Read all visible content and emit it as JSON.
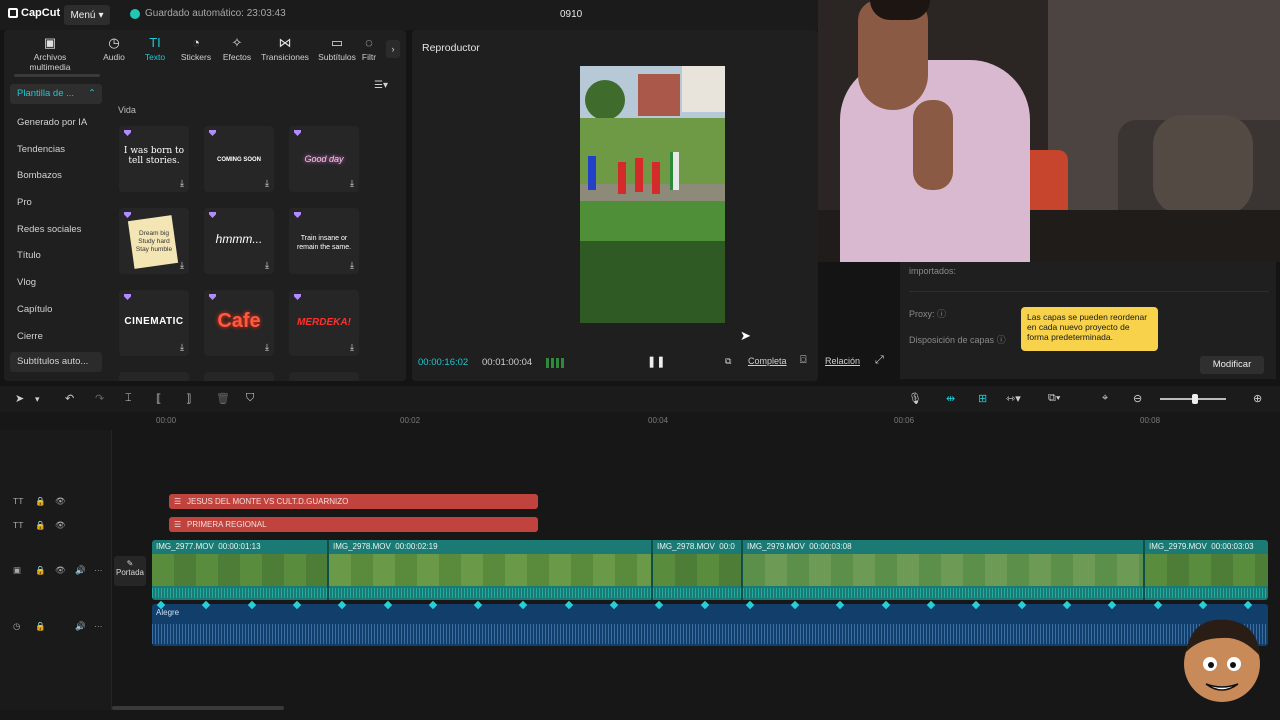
{
  "app": {
    "logo": "CapCut",
    "menu_label": "Menú",
    "autosave": "Guardado automático: 23:03:43",
    "project_name": "0910"
  },
  "toolbar": {
    "tools": [
      {
        "label": "Archivos multimedia",
        "icon": "media-icon"
      },
      {
        "label": "Audio",
        "icon": "audio-icon"
      },
      {
        "label": "Texto",
        "icon": "text-icon",
        "active": true
      },
      {
        "label": "Stickers",
        "icon": "sticker-icon"
      },
      {
        "label": "Efectos",
        "icon": "effects-icon"
      },
      {
        "label": "Transiciones",
        "icon": "transitions-icon"
      },
      {
        "label": "Subtítulos",
        "icon": "subtitles-icon"
      },
      {
        "label": "Filtr",
        "icon": "filters-icon"
      }
    ]
  },
  "categories": {
    "selected": "Plantilla de ...",
    "items": [
      "Generado por IA",
      "Tendencias",
      "Bombazos",
      "Pro",
      "Redes sociales",
      "Título",
      "Vlog",
      "Capítulo",
      "Cierre"
    ],
    "last": "Subtítulos auto..."
  },
  "templates": {
    "section": "Vida",
    "tiles": [
      {
        "text": "I was born to tell stories."
      },
      {
        "text": "COMING SOON"
      },
      {
        "text": "Good day"
      },
      {
        "text": "Dream big Study hard Stay humble"
      },
      {
        "text": "hmmm..."
      },
      {
        "text": "Train insane or remain the same."
      },
      {
        "text": "CINEMATIC"
      },
      {
        "text": "Cafe"
      },
      {
        "text": "MERDEKA!"
      }
    ]
  },
  "player": {
    "title": "Reproductor",
    "current_time": "00:00:16:02",
    "total_time": "00:01:00:04",
    "full_label": "Completa",
    "ratio_label": "Relación"
  },
  "right_panel": {
    "imported_label": "importados:",
    "proxy_label": "Proxy:",
    "layers_label": "Disposición de capas",
    "tooltip": "Las capas se pueden reordenar en cada nuevo proyecto de forma predeterminada.",
    "modify_label": "Modificar"
  },
  "timeline": {
    "ruler": [
      "00:00",
      "00:02",
      "00:04",
      "00:06",
      "00:08"
    ],
    "text_clips": [
      "JESUS DEL MONTE VS CULT.D.GUARNIZO",
      "PRIMERA REGIONAL"
    ],
    "cover_label": "Portada",
    "video_clips": [
      {
        "name": "IMG_2977.MOV",
        "dur": "00:00:01:13"
      },
      {
        "name": "IMG_2978.MOV",
        "dur": "00:00:02:19"
      },
      {
        "name": "IMG_2978.MOV",
        "dur": "00:0"
      },
      {
        "name": "IMG_2979.MOV",
        "dur": "00:00:03:08"
      },
      {
        "name": "IMG_2979.MOV",
        "dur": "00:00:03:03"
      }
    ],
    "audio_label": "Alegre"
  },
  "colors": {
    "accent": "#1fc8d2",
    "text_clip": "#c0443d",
    "video_track": "#1b7a73",
    "audio_track": "#123e6b",
    "tooltip": "#f7d24a"
  }
}
